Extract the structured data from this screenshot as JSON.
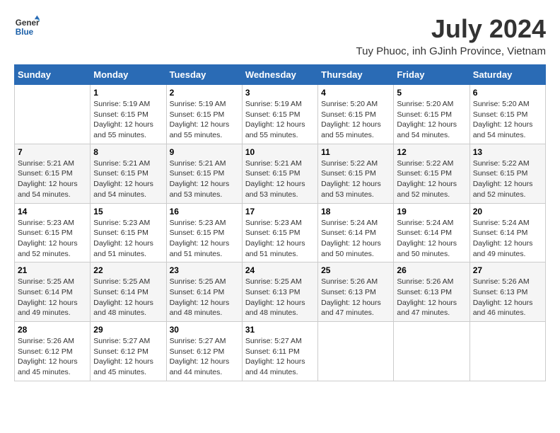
{
  "logo": {
    "line1": "General",
    "line2": "Blue"
  },
  "title": "July 2024",
  "location": "Tuy Phuoc, inh GJinh Province, Vietnam",
  "days_of_week": [
    "Sunday",
    "Monday",
    "Tuesday",
    "Wednesday",
    "Thursday",
    "Friday",
    "Saturday"
  ],
  "weeks": [
    [
      {
        "day": "",
        "sunrise": "",
        "sunset": "",
        "daylight": ""
      },
      {
        "day": "1",
        "sunrise": "Sunrise: 5:19 AM",
        "sunset": "Sunset: 6:15 PM",
        "daylight": "Daylight: 12 hours and 55 minutes."
      },
      {
        "day": "2",
        "sunrise": "Sunrise: 5:19 AM",
        "sunset": "Sunset: 6:15 PM",
        "daylight": "Daylight: 12 hours and 55 minutes."
      },
      {
        "day": "3",
        "sunrise": "Sunrise: 5:19 AM",
        "sunset": "Sunset: 6:15 PM",
        "daylight": "Daylight: 12 hours and 55 minutes."
      },
      {
        "day": "4",
        "sunrise": "Sunrise: 5:20 AM",
        "sunset": "Sunset: 6:15 PM",
        "daylight": "Daylight: 12 hours and 55 minutes."
      },
      {
        "day": "5",
        "sunrise": "Sunrise: 5:20 AM",
        "sunset": "Sunset: 6:15 PM",
        "daylight": "Daylight: 12 hours and 54 minutes."
      },
      {
        "day": "6",
        "sunrise": "Sunrise: 5:20 AM",
        "sunset": "Sunset: 6:15 PM",
        "daylight": "Daylight: 12 hours and 54 minutes."
      }
    ],
    [
      {
        "day": "7",
        "sunrise": "Sunrise: 5:21 AM",
        "sunset": "Sunset: 6:15 PM",
        "daylight": "Daylight: 12 hours and 54 minutes."
      },
      {
        "day": "8",
        "sunrise": "Sunrise: 5:21 AM",
        "sunset": "Sunset: 6:15 PM",
        "daylight": "Daylight: 12 hours and 54 minutes."
      },
      {
        "day": "9",
        "sunrise": "Sunrise: 5:21 AM",
        "sunset": "Sunset: 6:15 PM",
        "daylight": "Daylight: 12 hours and 53 minutes."
      },
      {
        "day": "10",
        "sunrise": "Sunrise: 5:21 AM",
        "sunset": "Sunset: 6:15 PM",
        "daylight": "Daylight: 12 hours and 53 minutes."
      },
      {
        "day": "11",
        "sunrise": "Sunrise: 5:22 AM",
        "sunset": "Sunset: 6:15 PM",
        "daylight": "Daylight: 12 hours and 53 minutes."
      },
      {
        "day": "12",
        "sunrise": "Sunrise: 5:22 AM",
        "sunset": "Sunset: 6:15 PM",
        "daylight": "Daylight: 12 hours and 52 minutes."
      },
      {
        "day": "13",
        "sunrise": "Sunrise: 5:22 AM",
        "sunset": "Sunset: 6:15 PM",
        "daylight": "Daylight: 12 hours and 52 minutes."
      }
    ],
    [
      {
        "day": "14",
        "sunrise": "Sunrise: 5:23 AM",
        "sunset": "Sunset: 6:15 PM",
        "daylight": "Daylight: 12 hours and 52 minutes."
      },
      {
        "day": "15",
        "sunrise": "Sunrise: 5:23 AM",
        "sunset": "Sunset: 6:15 PM",
        "daylight": "Daylight: 12 hours and 51 minutes."
      },
      {
        "day": "16",
        "sunrise": "Sunrise: 5:23 AM",
        "sunset": "Sunset: 6:15 PM",
        "daylight": "Daylight: 12 hours and 51 minutes."
      },
      {
        "day": "17",
        "sunrise": "Sunrise: 5:23 AM",
        "sunset": "Sunset: 6:15 PM",
        "daylight": "Daylight: 12 hours and 51 minutes."
      },
      {
        "day": "18",
        "sunrise": "Sunrise: 5:24 AM",
        "sunset": "Sunset: 6:14 PM",
        "daylight": "Daylight: 12 hours and 50 minutes."
      },
      {
        "day": "19",
        "sunrise": "Sunrise: 5:24 AM",
        "sunset": "Sunset: 6:14 PM",
        "daylight": "Daylight: 12 hours and 50 minutes."
      },
      {
        "day": "20",
        "sunrise": "Sunrise: 5:24 AM",
        "sunset": "Sunset: 6:14 PM",
        "daylight": "Daylight: 12 hours and 49 minutes."
      }
    ],
    [
      {
        "day": "21",
        "sunrise": "Sunrise: 5:25 AM",
        "sunset": "Sunset: 6:14 PM",
        "daylight": "Daylight: 12 hours and 49 minutes."
      },
      {
        "day": "22",
        "sunrise": "Sunrise: 5:25 AM",
        "sunset": "Sunset: 6:14 PM",
        "daylight": "Daylight: 12 hours and 48 minutes."
      },
      {
        "day": "23",
        "sunrise": "Sunrise: 5:25 AM",
        "sunset": "Sunset: 6:14 PM",
        "daylight": "Daylight: 12 hours and 48 minutes."
      },
      {
        "day": "24",
        "sunrise": "Sunrise: 5:25 AM",
        "sunset": "Sunset: 6:13 PM",
        "daylight": "Daylight: 12 hours and 48 minutes."
      },
      {
        "day": "25",
        "sunrise": "Sunrise: 5:26 AM",
        "sunset": "Sunset: 6:13 PM",
        "daylight": "Daylight: 12 hours and 47 minutes."
      },
      {
        "day": "26",
        "sunrise": "Sunrise: 5:26 AM",
        "sunset": "Sunset: 6:13 PM",
        "daylight": "Daylight: 12 hours and 47 minutes."
      },
      {
        "day": "27",
        "sunrise": "Sunrise: 5:26 AM",
        "sunset": "Sunset: 6:13 PM",
        "daylight": "Daylight: 12 hours and 46 minutes."
      }
    ],
    [
      {
        "day": "28",
        "sunrise": "Sunrise: 5:26 AM",
        "sunset": "Sunset: 6:12 PM",
        "daylight": "Daylight: 12 hours and 45 minutes."
      },
      {
        "day": "29",
        "sunrise": "Sunrise: 5:27 AM",
        "sunset": "Sunset: 6:12 PM",
        "daylight": "Daylight: 12 hours and 45 minutes."
      },
      {
        "day": "30",
        "sunrise": "Sunrise: 5:27 AM",
        "sunset": "Sunset: 6:12 PM",
        "daylight": "Daylight: 12 hours and 44 minutes."
      },
      {
        "day": "31",
        "sunrise": "Sunrise: 5:27 AM",
        "sunset": "Sunset: 6:11 PM",
        "daylight": "Daylight: 12 hours and 44 minutes."
      },
      {
        "day": "",
        "sunrise": "",
        "sunset": "",
        "daylight": ""
      },
      {
        "day": "",
        "sunrise": "",
        "sunset": "",
        "daylight": ""
      },
      {
        "day": "",
        "sunrise": "",
        "sunset": "",
        "daylight": ""
      }
    ]
  ]
}
